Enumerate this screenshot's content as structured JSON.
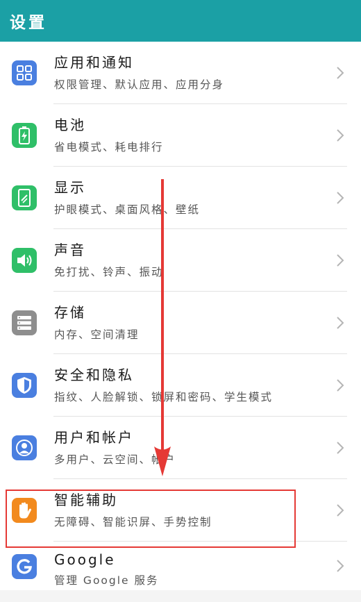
{
  "header": {
    "title": "设置"
  },
  "items": [
    {
      "key": "apps",
      "title": "应用和通知",
      "subtitle": "权限管理、默认应用、应用分身",
      "icon": "apps-grid-icon",
      "color": "#4a7fe0"
    },
    {
      "key": "battery",
      "title": "电池",
      "subtitle": "省电模式、耗电排行",
      "icon": "battery-icon",
      "color": "#2fbf68"
    },
    {
      "key": "display",
      "title": "显示",
      "subtitle": "护眼模式、桌面风格、壁纸",
      "icon": "display-icon",
      "color": "#2fbf68"
    },
    {
      "key": "sound",
      "title": "声音",
      "subtitle": "免打扰、铃声、振动",
      "icon": "speaker-icon",
      "color": "#2fbf68"
    },
    {
      "key": "storage",
      "title": "存储",
      "subtitle": "内存、空间清理",
      "icon": "storage-icon",
      "color": "#8e8e8e"
    },
    {
      "key": "security",
      "title": "安全和隐私",
      "subtitle": "指纹、人脸解锁、锁屏和密码、学生模式",
      "icon": "shield-icon",
      "color": "#4a7fe0"
    },
    {
      "key": "accounts",
      "title": "用户和帐户",
      "subtitle": "多用户、云空间、帐户",
      "icon": "user-icon",
      "color": "#4a7fe0"
    },
    {
      "key": "assist",
      "title": "智能辅助",
      "subtitle": "无障碍、智能识屏、手势控制",
      "icon": "hand-icon",
      "color": "#f28a1e"
    },
    {
      "key": "google",
      "title": "Google",
      "subtitle": "管理 Google 服务",
      "icon": "google-icon",
      "color": "#4a7fe0"
    }
  ],
  "colors": {
    "header": "#1ba0a5",
    "highlight": "#e53935",
    "arrow": "#e53935"
  }
}
